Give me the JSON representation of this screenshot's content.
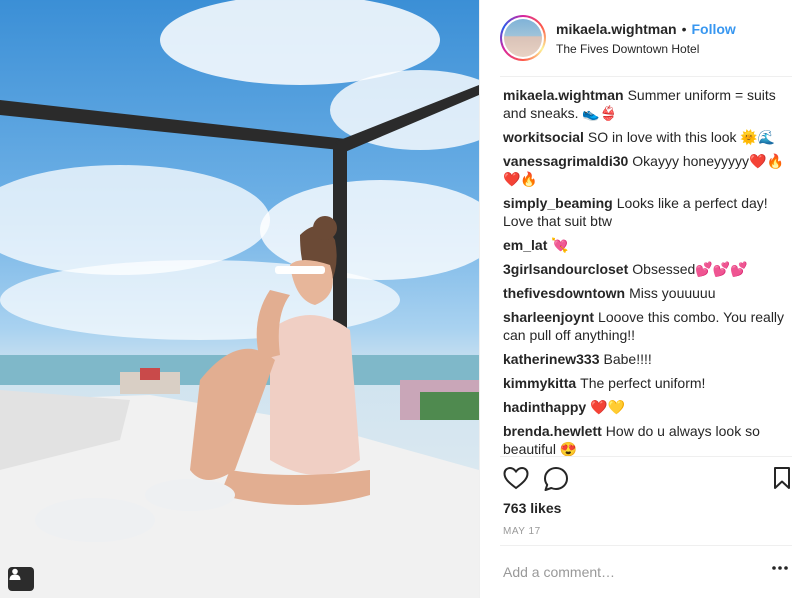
{
  "post": {
    "username": "mikaela.wightman",
    "separator": "•",
    "follow_label": "Follow",
    "location": "The Fives Downtown Hotel"
  },
  "comments": [
    {
      "user": "mikaela.wightman",
      "text": "Summer uniform = suits and sneaks. 👟👙"
    },
    {
      "user": "workitsocial",
      "text": "SO in love with this look 🌞🌊"
    },
    {
      "user": "vanessagrimaldi30",
      "text": "Okayyy honeyyyyy❤️🔥❤️🔥"
    },
    {
      "user": "simply_beaming",
      "text": "Looks like a perfect day! Love that suit btw"
    },
    {
      "user": "em_lat",
      "text": "💘"
    },
    {
      "user": "3girlsandourcloset",
      "text": "Obsessed💕💕💕"
    },
    {
      "user": "thefivesdowntown",
      "text": "Miss youuuuu"
    },
    {
      "user": "sharleenjoynt",
      "text": "Looove this combo. You really can pull off anything!!"
    },
    {
      "user": "katherinew333",
      "text": "Babe!!!!"
    },
    {
      "user": "kimmykitta",
      "text": "The perfect uniform!"
    },
    {
      "user": "hadinthappy",
      "text": "❤️💛"
    },
    {
      "user": "brenda.hewlett",
      "text": "How do u always look so beautiful 😍"
    }
  ],
  "likes": "763 likes",
  "date": "MAY 17",
  "add_comment_placeholder": "Add a comment…",
  "icons": {
    "like": "heart-icon",
    "comment": "comment-icon",
    "save": "bookmark-icon",
    "more": "more-options-icon",
    "user_tag": "user-tag-icon"
  },
  "colors": {
    "follow": "#3897f0",
    "text": "#262626",
    "muted": "#999999"
  }
}
